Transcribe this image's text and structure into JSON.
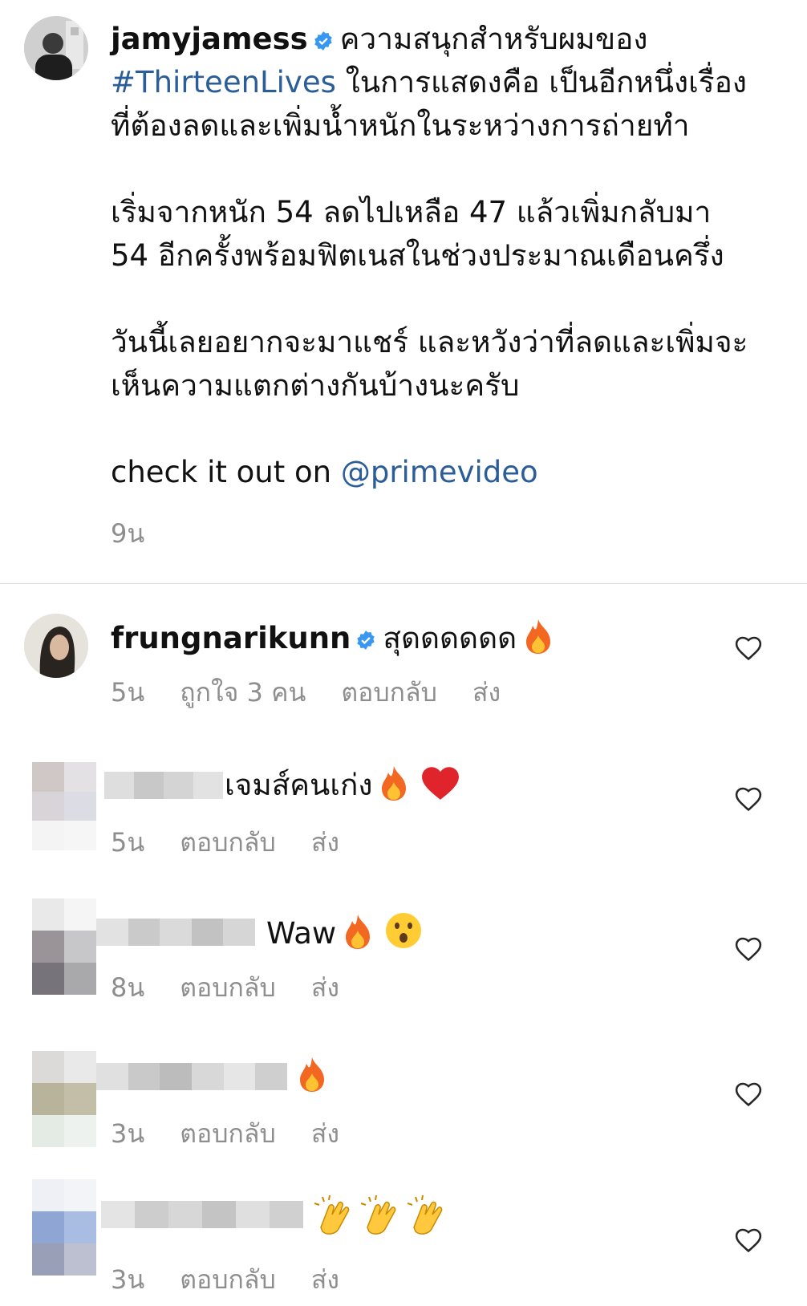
{
  "post": {
    "username": "jamyjamess",
    "caption_lead": "ความสนุกสำหรับผมของ",
    "hashtag": "#ThirteenLives",
    "caption_line1_rest": " ในการแสดงคือ เป็นอีกหนึ่งเรื่อง",
    "caption_line2": "ที่ต้องลดและเพิ่มน้ำหนักในระหว่างการถ่ายทำ",
    "caption_para2_line1": "เริ่มจากหนัก 54 ลดไปเหลือ 47 แล้วเพิ่มกลับมา",
    "caption_para2_line2": "54 อีกครั้งพร้อมฟิตเนสในช่วงประมาณเดือนครึ่ง",
    "caption_para3_line1": "วันนี้เลยอยากจะมาแชร์ และหวังว่าที่ลดและเพิ่มจะ",
    "caption_para3_line2": "เห็นความแตกต่างกันบ้างนะครับ",
    "caption_para4_text": "check it out on ",
    "caption_mention": "@primevideo",
    "time": "9น"
  },
  "comments": [
    {
      "username": "frungnarikunn",
      "text": "สุดดดดดด",
      "time": "5น",
      "likes": "ถูกใจ 3 คน",
      "reply": "ตอบกลับ",
      "send": "ส่ง"
    },
    {
      "text": "เจมส์คนเก่ง",
      "time": "5น",
      "reply": "ตอบกลับ",
      "send": "ส่ง"
    },
    {
      "text": "Waw",
      "time": "8น",
      "reply": "ตอบกลับ",
      "send": "ส่ง"
    },
    {
      "text": "",
      "time": "3น",
      "reply": "ตอบกลับ",
      "send": "ส่ง"
    },
    {
      "text": "",
      "time": "3น",
      "reply": "ตอบกลับ",
      "send": "ส่ง"
    }
  ],
  "colors": {
    "link": "#2b5d99",
    "verified": "#3897f0",
    "meta": "#8e8e8e"
  }
}
